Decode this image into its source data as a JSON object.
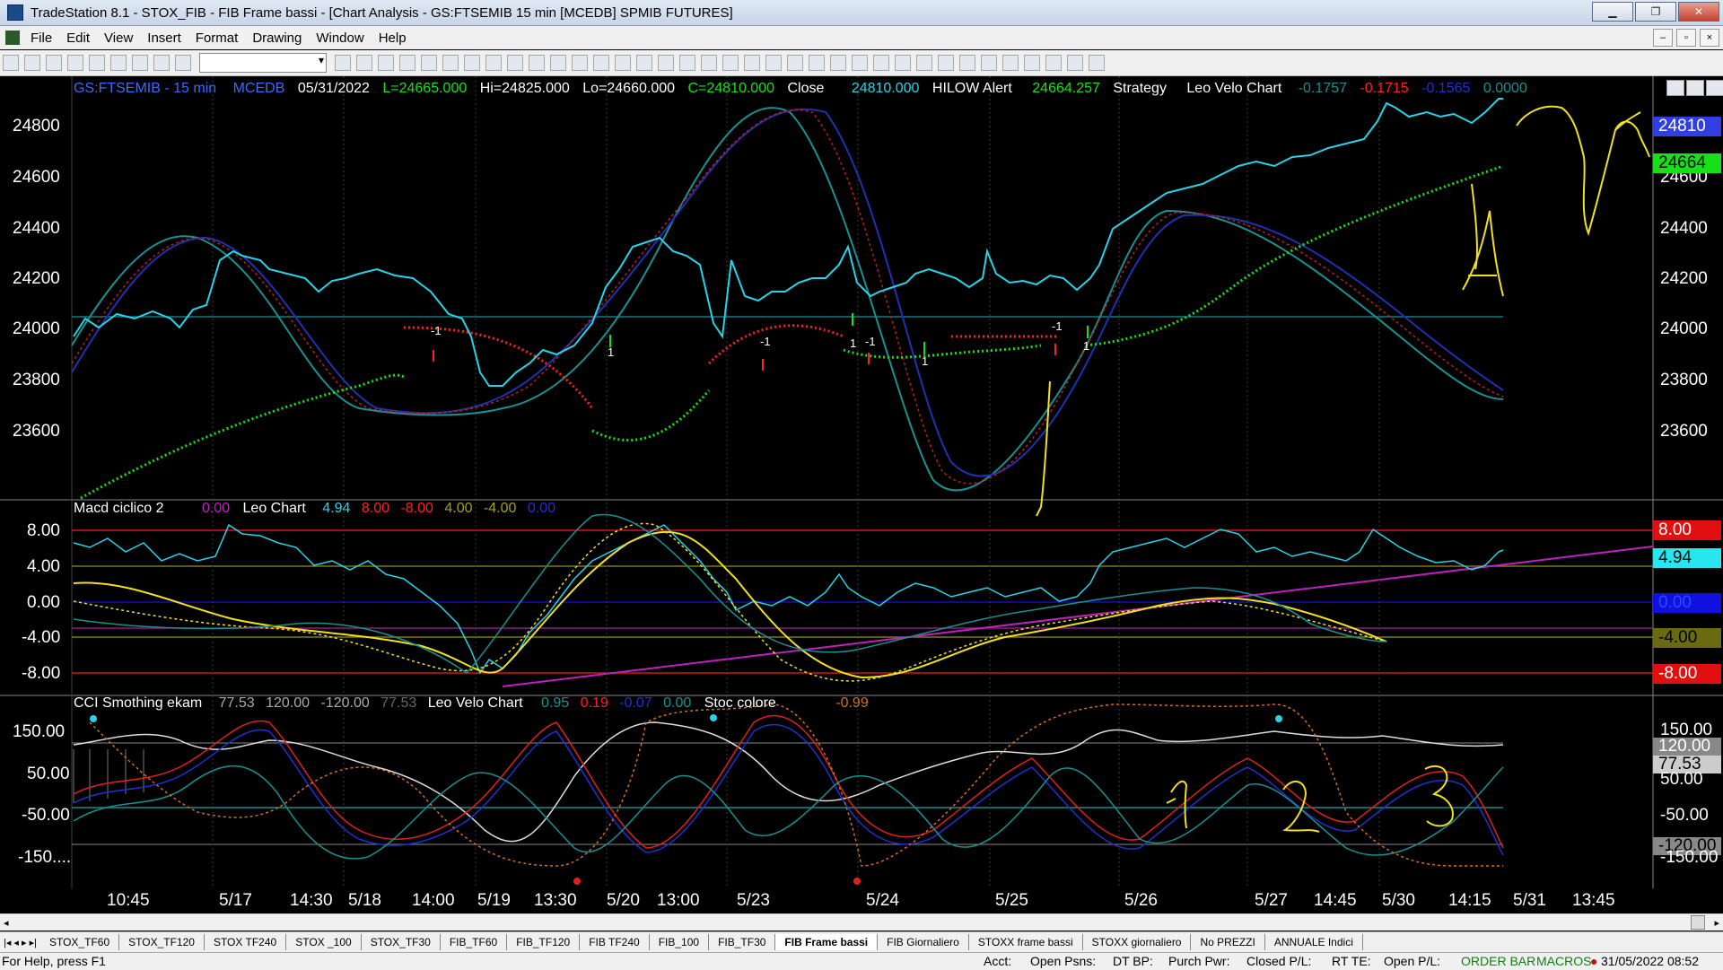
{
  "window": {
    "title": "TradeStation 8.1 - STOX_FIB - FIB Frame bassi - [Chart Analysis - GS:FTSEMIB  15 min  [MCEDB] SPMIB FUTURES]"
  },
  "window_buttons": {
    "minimize": "▁",
    "restore": "❐",
    "close": "✕"
  },
  "menu": [
    "File",
    "Edit",
    "View",
    "Insert",
    "Format",
    "Drawing",
    "Window",
    "Help"
  ],
  "chart_header": {
    "symbol": "GS:FTSEMIB - 15 min",
    "source": "MCEDB",
    "date": "05/31/2022",
    "low_label": "L=24665.000",
    "high_label": "Hi=24825.000",
    "lo_label": "Lo=24660.000",
    "close_label": "C=24810.000",
    "close_text": "Close",
    "close_value": "24810.000",
    "hilow_text": "HILOW Alert",
    "hilow_value": "24664.257",
    "strategy_text": "Strategy",
    "leo_text": "Leo Velo Chart",
    "leo_v1": "-0.1757",
    "leo_v2": "-0.1715",
    "leo_v3": "-0.1565",
    "leo_v4": "0.0000"
  },
  "price_axis": [
    "24800",
    "24600",
    "24400",
    "24200",
    "24000",
    "23800",
    "23600"
  ],
  "price_badges": {
    "last": "24810",
    "hilow": "24664"
  },
  "macd_header": {
    "name": "Macd ciclico 2",
    "v0": "0.00",
    "leo": "Leo Chart",
    "a": "4.94",
    "b": "8.00",
    "c": "-8.00",
    "d": "4.00",
    "e": "-4.00",
    "f": "0.00"
  },
  "macd_axis": [
    "8.00",
    "4.00",
    "0.00",
    "-4.00",
    "-8.00"
  ],
  "macd_badges": [
    "8.00",
    "4.94",
    "0.00",
    "-4.00",
    "-8.00"
  ],
  "cci_header": {
    "name": "CCI Smothing ekam",
    "a": "77.53",
    "b": "120.00",
    "c": "-120.00",
    "d": "77.53",
    "leo": "Leo Velo Chart",
    "l1": "0.95",
    "l2": "0.19",
    "l3": "-0.07",
    "l4": "0.00",
    "stoc": "Stoc colore",
    "stoc_v": "-0.99"
  },
  "cci_axis": [
    "150.00",
    "50.00",
    "-50.00",
    "-150...."
  ],
  "cci_badges": [
    "150.00",
    "120.00",
    "77.53",
    "50.00",
    "-50.00",
    "-120.00",
    "-150.00"
  ],
  "time_axis": [
    "10:45",
    "5/17",
    "14:30",
    "5/18",
    "14:00",
    "5/19",
    "13:30",
    "5/20",
    "13:00",
    "5/23",
    "5/24",
    "5/25",
    "5/26",
    "5/27",
    "14:45",
    "5/30",
    "14:15",
    "5/31",
    "13:45"
  ],
  "annotations": {
    "a": "A",
    "n1": "1",
    "n2": "2",
    "n3": "3"
  },
  "tabs": [
    "STOX_TF60",
    "STOX_TF120",
    "STOX TF240",
    "STOX _100",
    "STOX_TF30",
    "FIB_TF60",
    "FIB_TF120",
    "FIB TF240",
    "FIB_100",
    "FIB_TF30",
    "FIB Frame bassi",
    "FIB Giornaliero",
    "STOXX frame bassi",
    "STOXX giornaliero",
    "No PREZZI",
    "ANNUALE Indici"
  ],
  "status": {
    "help": "For Help, press F1",
    "acct": "Acct:",
    "open_psns": "Open Psns:",
    "dt_bp": "DT BP:",
    "purch_pwr": "Purch Pwr:",
    "closed_pl": "Closed P/L:",
    "rt_te": "RT TE:",
    "open_pl": "Open P/L:",
    "order_bar": "ORDER BAR",
    "macros": "MACROS",
    "datetime": "31/05/2022 08:52"
  },
  "colors": {
    "cyan": "#27d3e6",
    "green": "#18e018",
    "red": "#ff2020",
    "yellow": "#f0e020",
    "magenta": "#c020c0",
    "navy": "#1a2a9a"
  }
}
